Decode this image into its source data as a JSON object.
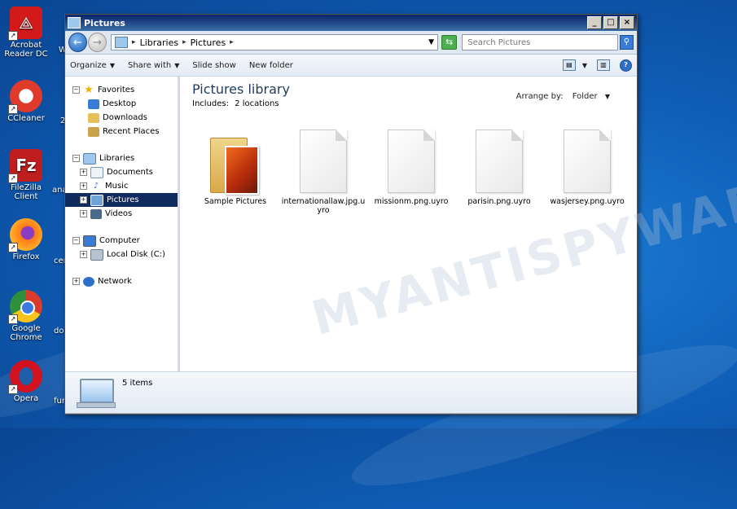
{
  "desktop": {
    "icons": [
      {
        "label": "Acrobat Reader DC",
        "icon": "acrobat-icon",
        "color": "#d21a1a"
      },
      {
        "label": "CCleaner",
        "icon": "ccleaner-icon",
        "color": "#e03b2a"
      },
      {
        "label": "FileZilla Client",
        "icon": "filezilla-icon",
        "color": "#bf1e1e"
      },
      {
        "label": "Firefox",
        "icon": "firefox-icon",
        "color": "#ff7a18"
      },
      {
        "label": "Google Chrome",
        "icon": "chrome-icon",
        "color": "#2f8f3a"
      },
      {
        "label": "Opera",
        "icon": "opera-icon",
        "color": "#d3121f"
      }
    ],
    "partial_labels": [
      "W",
      "2",
      "ana",
      "cen",
      "doc",
      "fur"
    ]
  },
  "window": {
    "title": "Pictures",
    "controls": {
      "minimize": "_",
      "maximize": "□",
      "close": "×"
    }
  },
  "address": {
    "crumbs": [
      "Libraries",
      "Pictures"
    ],
    "search_placeholder": "Search Pictures"
  },
  "toolbar": {
    "organize": "Organize",
    "share_with": "Share with",
    "slide_show": "Slide show",
    "new_folder": "New folder"
  },
  "nav": {
    "favorites": {
      "label": "Favorites",
      "items": [
        "Desktop",
        "Downloads",
        "Recent Places"
      ]
    },
    "libraries": {
      "label": "Libraries",
      "items": [
        "Documents",
        "Music",
        "Pictures",
        "Videos"
      ],
      "selected": "Pictures"
    },
    "computer": {
      "label": "Computer",
      "items": [
        "Local Disk (C:)"
      ]
    },
    "network": {
      "label": "Network"
    }
  },
  "content": {
    "title": "Pictures library",
    "includes": "Includes:",
    "locations": "2 locations",
    "arrange_label": "Arrange by:",
    "arrange_value": "Folder",
    "files": [
      {
        "name": "Sample Pictures",
        "type": "folder"
      },
      {
        "name": "internationallaw.jpg.uyro",
        "type": "file"
      },
      {
        "name": "missionm.png.uyro",
        "type": "file"
      },
      {
        "name": "parisin.png.uyro",
        "type": "file"
      },
      {
        "name": "wasjersey.png.uyro",
        "type": "file"
      }
    ],
    "watermark": "MYANTISPYWARE.COM"
  },
  "status": {
    "count": "5 items"
  },
  "colors": {
    "selection": "#0f2a5c",
    "title_blue": "#1e3a5f",
    "desktop_bg": "#1468c4"
  }
}
